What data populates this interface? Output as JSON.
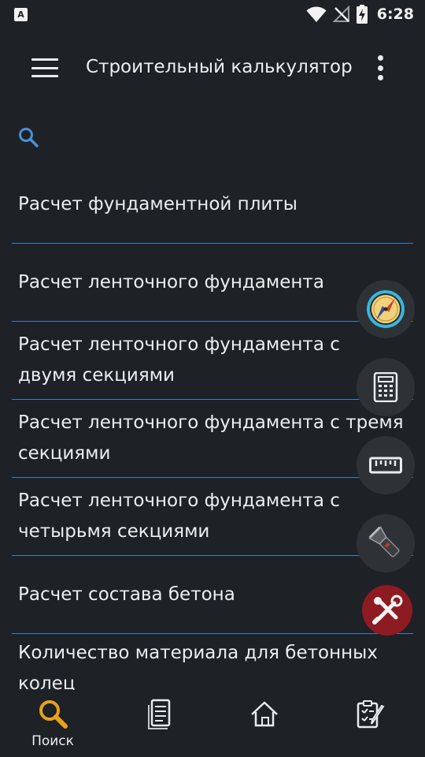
{
  "status_bar": {
    "app_badge": "A",
    "time": "6:28",
    "icons": [
      "wifi-icon",
      "no-signal-icon",
      "battery-charging-icon"
    ]
  },
  "app_bar": {
    "title": "Строительный калькулятор",
    "menu_icon": "hamburger-menu-icon",
    "more_icon": "more-vert-icon"
  },
  "search": {
    "icon": "search-icon",
    "value": ""
  },
  "list": {
    "items": [
      {
        "label": "Расчет фундаментной плиты"
      },
      {
        "label": "Расчет ленточного фундамента"
      },
      {
        "label": "Расчет ленточного фундамента с двумя секциями"
      },
      {
        "label": "Расчет ленточного фундамента с тремя секциями"
      },
      {
        "label": "Расчет ленточного фундамента с четырьмя секциями"
      },
      {
        "label": "Расчет состава бетона"
      },
      {
        "label": "Количество материала для бетонных колец"
      }
    ]
  },
  "fabs": [
    {
      "icon": "compass-icon"
    },
    {
      "icon": "calculator-icon"
    },
    {
      "icon": "ruler-icon"
    },
    {
      "icon": "flashlight-icon"
    },
    {
      "icon": "tools-icon"
    }
  ],
  "bottom_nav": {
    "items": [
      {
        "icon": "search-nav-icon",
        "label": "Поиск"
      },
      {
        "icon": "document-icon",
        "label": ""
      },
      {
        "icon": "home-icon",
        "label": ""
      },
      {
        "icon": "checklist-edit-icon",
        "label": ""
      }
    ]
  },
  "colors": {
    "background": "#1e2125",
    "divider": "#3f7fc2",
    "accent": "#4a8fd9",
    "search_nav_active": "#e8a21a",
    "tools_fab": "#8d1b21"
  }
}
